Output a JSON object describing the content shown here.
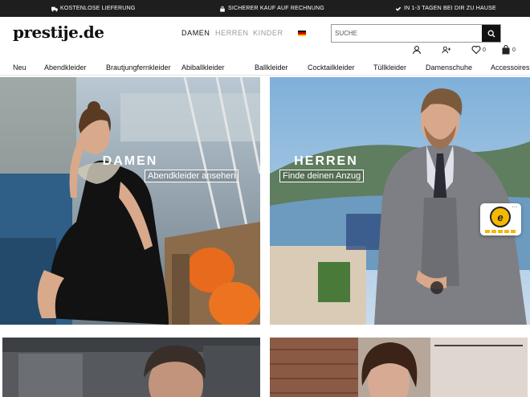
{
  "topbar": {
    "usps": [
      {
        "icon": "truck-icon",
        "text": "KOSTENLOSE LIEFERUNG"
      },
      {
        "icon": "lock-icon",
        "text": "SICHERER KAUF AUF RECHNUNG"
      },
      {
        "icon": "check-icon",
        "text": "IN 1-3 TAGEN BEI DIR ZU HAUSE"
      }
    ]
  },
  "header": {
    "logo": "prestije.de",
    "genders": [
      {
        "label": "DAMEN",
        "active": true
      },
      {
        "label": "HERREN",
        "active": false
      },
      {
        "label": "KINDER",
        "active": false
      }
    ],
    "language": "german-flag-icon",
    "search": {
      "placeholder": "SUCHE"
    },
    "wishlist_count": "0",
    "cart_count": "0"
  },
  "nav": {
    "items": [
      "Neu",
      "Abendkleider",
      "Brautjungfernkleider",
      "Abiballkleider",
      "Ballkleider",
      "Cocktailkleider",
      "Tüllkleider",
      "Damenschuhe",
      "Accessoires"
    ]
  },
  "banners": {
    "damen": {
      "title": "DAMEN",
      "button": "Abendkleider ansehen"
    },
    "herren": {
      "title": "HERREN",
      "button": "Finde deinen Anzug"
    }
  },
  "trust_badge": {
    "label": "e",
    "menu": "···"
  },
  "colors": {
    "topbar": "#1e1e1e",
    "accent": "#111111",
    "muted": "#999999",
    "flag_black": "#000000",
    "flag_red": "#dd0000",
    "flag_gold": "#ffce00"
  }
}
